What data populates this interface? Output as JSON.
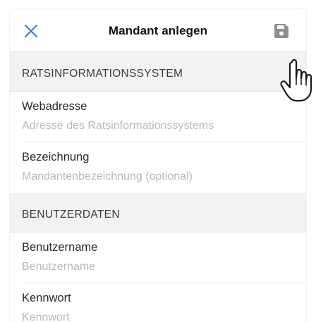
{
  "navbar": {
    "title": "Mandant anlegen",
    "close_icon": "close-icon",
    "save_icon": "save-floppy-icon"
  },
  "sections": [
    {
      "header": "RATSINFORMATIONSSYSTEM",
      "fields": [
        {
          "label": "Webadresse",
          "value": "",
          "placeholder": "Adresse des Ratsinformationssystems"
        },
        {
          "label": "Bezeichnung",
          "value": "",
          "placeholder": "Mandantenbezeichnung (optional)"
        }
      ]
    },
    {
      "header": "BENUTZERDATEN",
      "fields": [
        {
          "label": "Benutzername",
          "value": "",
          "placeholder": "Benutzername"
        },
        {
          "label": "Kennwort",
          "value": "",
          "placeholder": "Kennwort"
        }
      ]
    }
  ],
  "colors": {
    "accent": "#2f7ad8",
    "save_icon": "#8e8e93",
    "section_bg": "#f2f2f4",
    "placeholder": "#b9b9bd"
  },
  "overlay": {
    "pointer_icon": "hand-pointer-icon"
  }
}
